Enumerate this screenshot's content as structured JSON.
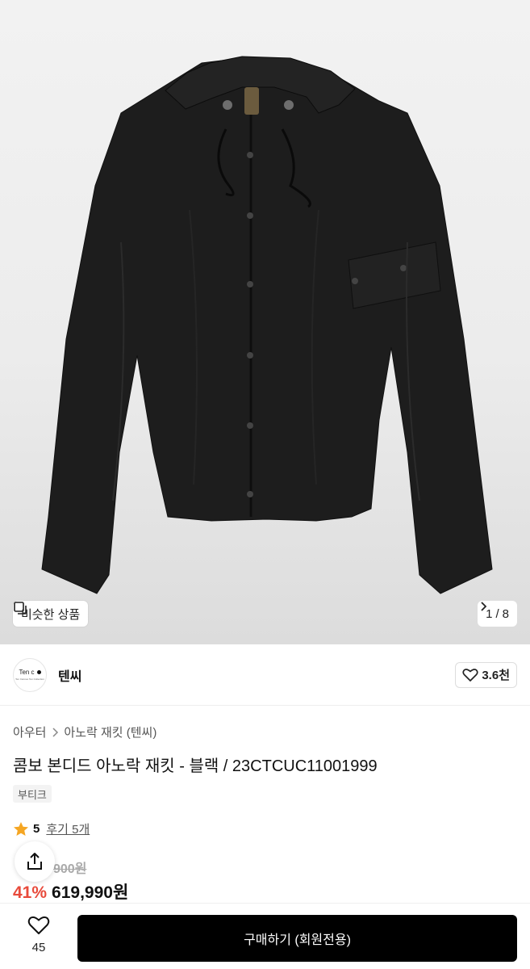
{
  "gallery": {
    "similar_label": "비슷한 상품",
    "page_current": "1",
    "page_separator": "/",
    "page_total": "8"
  },
  "brand": {
    "name": "텐씨",
    "logo_text": "Ten c",
    "logo_subtext": "Ten Cannes Ten Collection",
    "like_count": "3.6천"
  },
  "breadcrumb": {
    "category": "아우터",
    "subcategory": "아노락 재킷 (텐씨)"
  },
  "product": {
    "title": "콤보 본디드 아노락 재킷 - 블랙 / 23CTCUC11001999",
    "tag": "부티크",
    "rating": "5",
    "reviews": "후기 5개",
    "original_price": "900원",
    "discount": "41%",
    "price": "619,990원"
  },
  "bottom": {
    "like_count": "45",
    "buy_label": "구매하기 (회원전용)"
  },
  "colors": {
    "accent_red": "#e84a3b",
    "star": "#f5a623",
    "buy_bg": "#000000"
  }
}
